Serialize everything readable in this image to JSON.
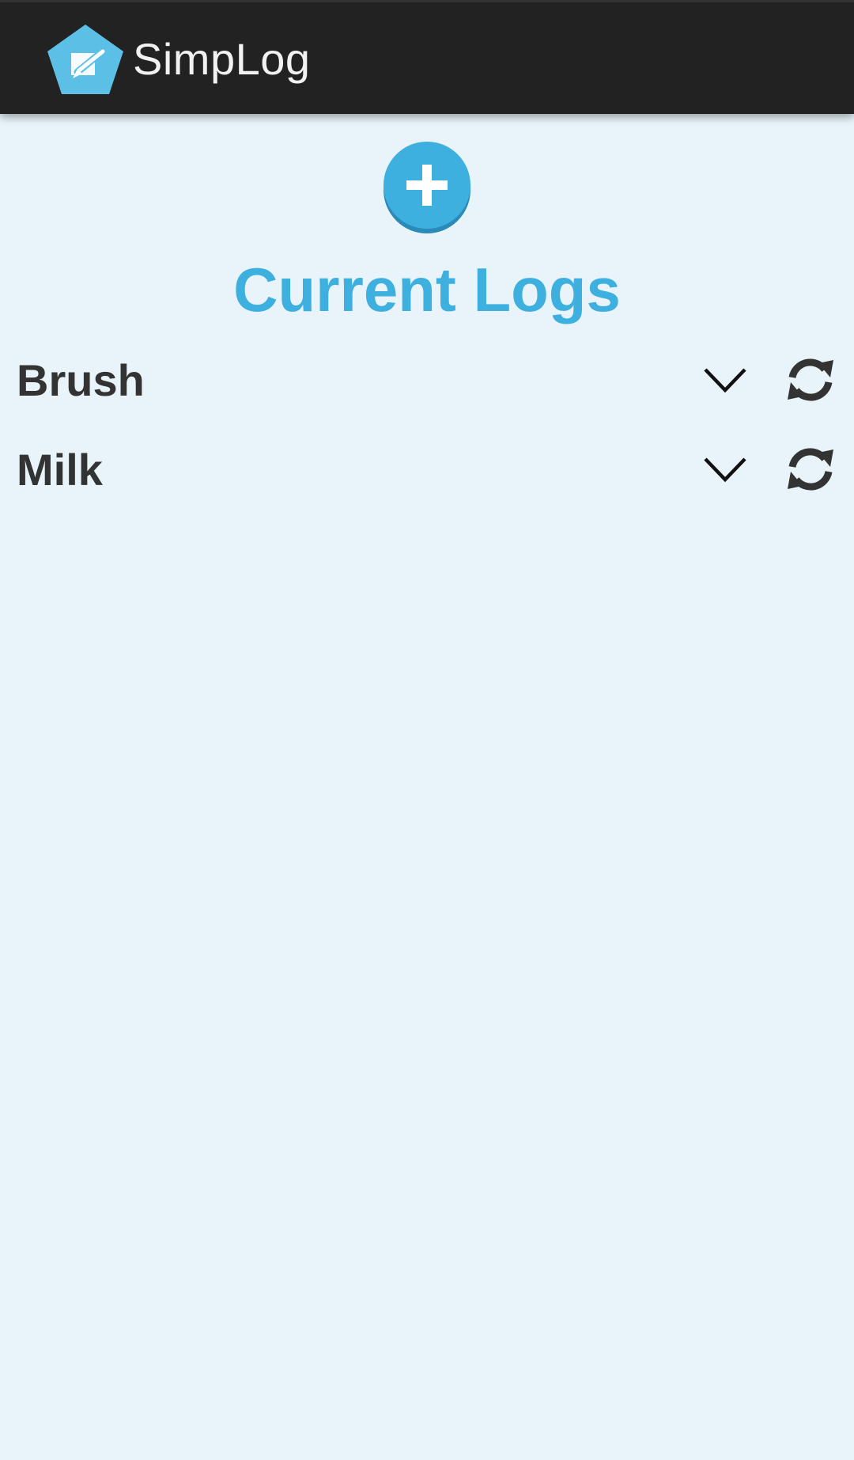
{
  "app": {
    "title": "SimpLog",
    "logo_icon": "pentagon-pencil-icon",
    "brand_color": "#5bbfe6",
    "action_bar_color": "#222222"
  },
  "add_button": {
    "icon": "plus-icon",
    "color": "#3eb0e0"
  },
  "section": {
    "title": "Current Logs"
  },
  "logs": [
    {
      "name": "Brush",
      "expand_icon": "chevron-down-icon",
      "reset_icon": "refresh-icon"
    },
    {
      "name": "Milk",
      "expand_icon": "chevron-down-icon",
      "reset_icon": "refresh-icon"
    }
  ]
}
